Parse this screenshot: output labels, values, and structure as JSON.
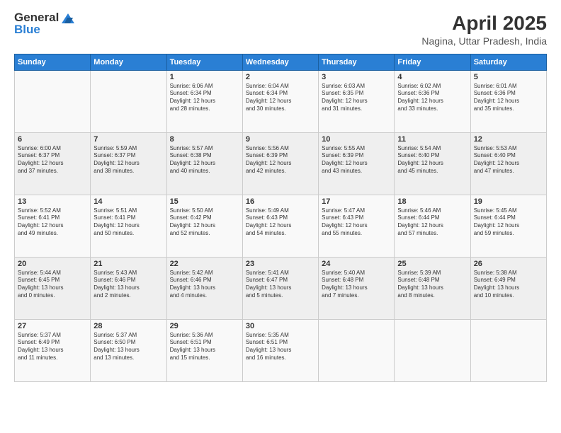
{
  "header": {
    "logo_line1": "General",
    "logo_line2": "Blue",
    "title": "April 2025",
    "subtitle": "Nagina, Uttar Pradesh, India"
  },
  "days_of_week": [
    "Sunday",
    "Monday",
    "Tuesday",
    "Wednesday",
    "Thursday",
    "Friday",
    "Saturday"
  ],
  "weeks": [
    [
      {
        "day": "",
        "info": ""
      },
      {
        "day": "",
        "info": ""
      },
      {
        "day": "1",
        "info": "Sunrise: 6:06 AM\nSunset: 6:34 PM\nDaylight: 12 hours\nand 28 minutes."
      },
      {
        "day": "2",
        "info": "Sunrise: 6:04 AM\nSunset: 6:34 PM\nDaylight: 12 hours\nand 30 minutes."
      },
      {
        "day": "3",
        "info": "Sunrise: 6:03 AM\nSunset: 6:35 PM\nDaylight: 12 hours\nand 31 minutes."
      },
      {
        "day": "4",
        "info": "Sunrise: 6:02 AM\nSunset: 6:36 PM\nDaylight: 12 hours\nand 33 minutes."
      },
      {
        "day": "5",
        "info": "Sunrise: 6:01 AM\nSunset: 6:36 PM\nDaylight: 12 hours\nand 35 minutes."
      }
    ],
    [
      {
        "day": "6",
        "info": "Sunrise: 6:00 AM\nSunset: 6:37 PM\nDaylight: 12 hours\nand 37 minutes."
      },
      {
        "day": "7",
        "info": "Sunrise: 5:59 AM\nSunset: 6:37 PM\nDaylight: 12 hours\nand 38 minutes."
      },
      {
        "day": "8",
        "info": "Sunrise: 5:57 AM\nSunset: 6:38 PM\nDaylight: 12 hours\nand 40 minutes."
      },
      {
        "day": "9",
        "info": "Sunrise: 5:56 AM\nSunset: 6:39 PM\nDaylight: 12 hours\nand 42 minutes."
      },
      {
        "day": "10",
        "info": "Sunrise: 5:55 AM\nSunset: 6:39 PM\nDaylight: 12 hours\nand 43 minutes."
      },
      {
        "day": "11",
        "info": "Sunrise: 5:54 AM\nSunset: 6:40 PM\nDaylight: 12 hours\nand 45 minutes."
      },
      {
        "day": "12",
        "info": "Sunrise: 5:53 AM\nSunset: 6:40 PM\nDaylight: 12 hours\nand 47 minutes."
      }
    ],
    [
      {
        "day": "13",
        "info": "Sunrise: 5:52 AM\nSunset: 6:41 PM\nDaylight: 12 hours\nand 49 minutes."
      },
      {
        "day": "14",
        "info": "Sunrise: 5:51 AM\nSunset: 6:41 PM\nDaylight: 12 hours\nand 50 minutes."
      },
      {
        "day": "15",
        "info": "Sunrise: 5:50 AM\nSunset: 6:42 PM\nDaylight: 12 hours\nand 52 minutes."
      },
      {
        "day": "16",
        "info": "Sunrise: 5:49 AM\nSunset: 6:43 PM\nDaylight: 12 hours\nand 54 minutes."
      },
      {
        "day": "17",
        "info": "Sunrise: 5:47 AM\nSunset: 6:43 PM\nDaylight: 12 hours\nand 55 minutes."
      },
      {
        "day": "18",
        "info": "Sunrise: 5:46 AM\nSunset: 6:44 PM\nDaylight: 12 hours\nand 57 minutes."
      },
      {
        "day": "19",
        "info": "Sunrise: 5:45 AM\nSunset: 6:44 PM\nDaylight: 12 hours\nand 59 minutes."
      }
    ],
    [
      {
        "day": "20",
        "info": "Sunrise: 5:44 AM\nSunset: 6:45 PM\nDaylight: 13 hours\nand 0 minutes."
      },
      {
        "day": "21",
        "info": "Sunrise: 5:43 AM\nSunset: 6:46 PM\nDaylight: 13 hours\nand 2 minutes."
      },
      {
        "day": "22",
        "info": "Sunrise: 5:42 AM\nSunset: 6:46 PM\nDaylight: 13 hours\nand 4 minutes."
      },
      {
        "day": "23",
        "info": "Sunrise: 5:41 AM\nSunset: 6:47 PM\nDaylight: 13 hours\nand 5 minutes."
      },
      {
        "day": "24",
        "info": "Sunrise: 5:40 AM\nSunset: 6:48 PM\nDaylight: 13 hours\nand 7 minutes."
      },
      {
        "day": "25",
        "info": "Sunrise: 5:39 AM\nSunset: 6:48 PM\nDaylight: 13 hours\nand 8 minutes."
      },
      {
        "day": "26",
        "info": "Sunrise: 5:38 AM\nSunset: 6:49 PM\nDaylight: 13 hours\nand 10 minutes."
      }
    ],
    [
      {
        "day": "27",
        "info": "Sunrise: 5:37 AM\nSunset: 6:49 PM\nDaylight: 13 hours\nand 11 minutes."
      },
      {
        "day": "28",
        "info": "Sunrise: 5:37 AM\nSunset: 6:50 PM\nDaylight: 13 hours\nand 13 minutes."
      },
      {
        "day": "29",
        "info": "Sunrise: 5:36 AM\nSunset: 6:51 PM\nDaylight: 13 hours\nand 15 minutes."
      },
      {
        "day": "30",
        "info": "Sunrise: 5:35 AM\nSunset: 6:51 PM\nDaylight: 13 hours\nand 16 minutes."
      },
      {
        "day": "",
        "info": ""
      },
      {
        "day": "",
        "info": ""
      },
      {
        "day": "",
        "info": ""
      }
    ]
  ]
}
